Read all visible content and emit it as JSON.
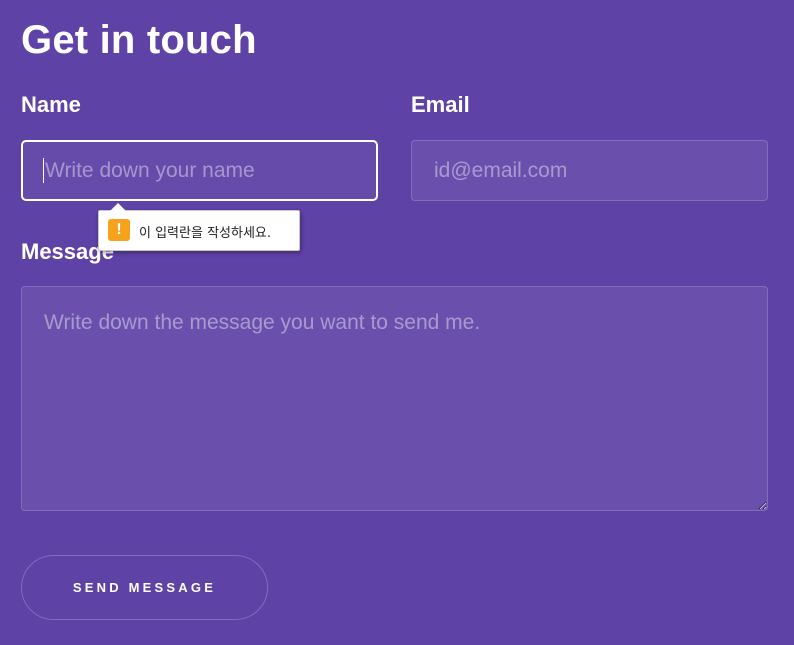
{
  "header": {
    "title": "Get in touch"
  },
  "form": {
    "name": {
      "label": "Name",
      "value": "",
      "placeholder": "Write down your name"
    },
    "email": {
      "label": "Email",
      "value": "",
      "placeholder": "id@email.com"
    },
    "message": {
      "label": "Message",
      "value": "",
      "placeholder": "Write down the message you want to send me."
    },
    "submit_label": "SEND MESSAGE"
  },
  "validation_tooltip": {
    "icon": "warning-icon",
    "icon_glyph": "!",
    "text": "이 입력란을 작성하세요."
  },
  "colors": {
    "background": "#5e42a6",
    "text": "#ffffff",
    "warning": "#f7a21b"
  }
}
